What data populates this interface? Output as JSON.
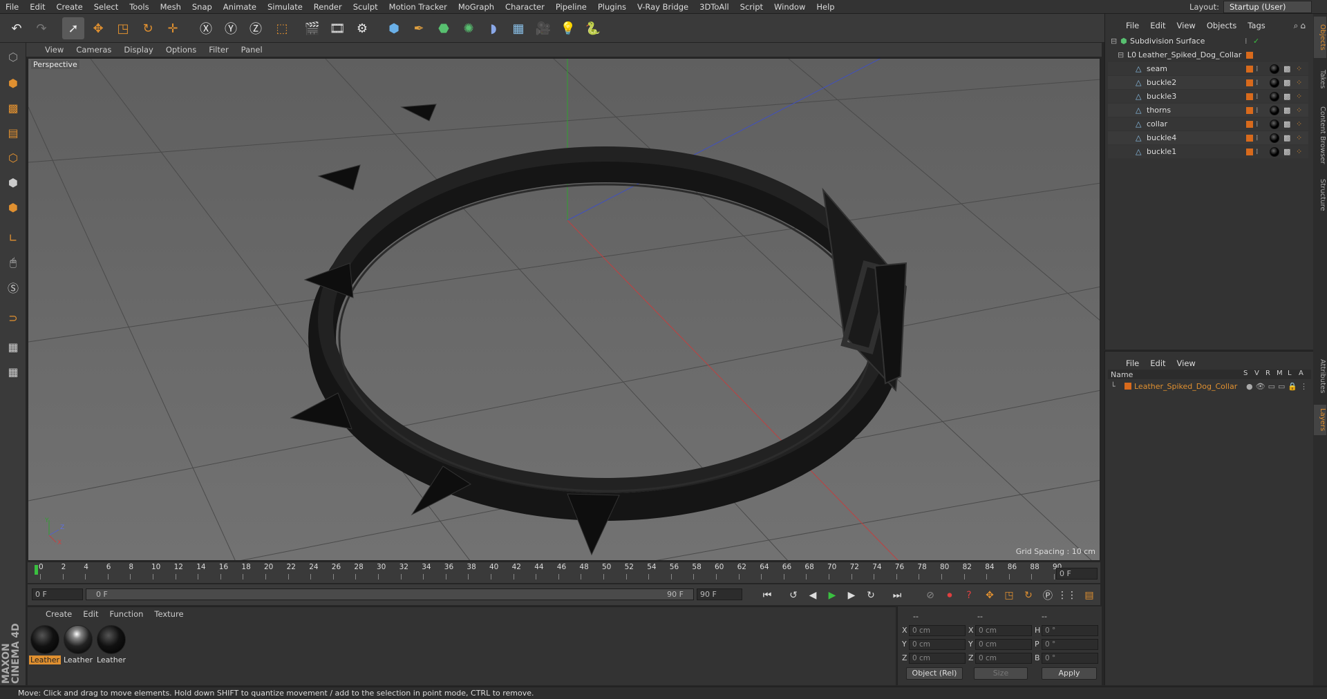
{
  "menubar": {
    "items": [
      "File",
      "Edit",
      "Create",
      "Select",
      "Tools",
      "Mesh",
      "Snap",
      "Animate",
      "Simulate",
      "Render",
      "Sculpt",
      "Motion Tracker",
      "MoGraph",
      "Character",
      "Pipeline",
      "Plugins",
      "V-Ray Bridge",
      "3DToAll",
      "Script",
      "Window",
      "Help"
    ],
    "layout_label": "Layout:",
    "layout_value": "Startup (User)"
  },
  "viewport": {
    "menu": [
      "View",
      "Cameras",
      "Display",
      "Options",
      "Filter",
      "Panel"
    ],
    "label": "Perspective",
    "grid_spacing": "Grid Spacing : 10 cm",
    "axis_x": "X",
    "axis_y": "Y",
    "axis_z": "Z"
  },
  "timeline": {
    "ticks": [
      "0",
      "2",
      "4",
      "6",
      "8",
      "10",
      "12",
      "14",
      "16",
      "18",
      "20",
      "22",
      "24",
      "26",
      "28",
      "30",
      "32",
      "34",
      "36",
      "38",
      "40",
      "42",
      "44",
      "46",
      "48",
      "50",
      "52",
      "54",
      "56",
      "58",
      "60",
      "62",
      "64",
      "66",
      "68",
      "70",
      "72",
      "74",
      "76",
      "78",
      "80",
      "82",
      "84",
      "86",
      "88",
      "90"
    ],
    "end_field": "0 F"
  },
  "playbar": {
    "start": "0 F",
    "range_start": "0 F",
    "range_end": "90 F",
    "end": "90 F"
  },
  "materials": {
    "menu": [
      "Create",
      "Edit",
      "Function",
      "Texture"
    ],
    "items": [
      "Leather",
      "Leather",
      "Leather"
    ]
  },
  "coords": {
    "rows": [
      {
        "l1": "X",
        "v1": "0 cm",
        "l2": "X",
        "v2": "0 cm",
        "l3": "H",
        "v3": "0 °"
      },
      {
        "l1": "Y",
        "v1": "0 cm",
        "l2": "Y",
        "v2": "0 cm",
        "l3": "P",
        "v3": "0 °"
      },
      {
        "l1": "Z",
        "v1": "0 cm",
        "l2": "Z",
        "v2": "0 cm",
        "l3": "B",
        "v3": "0 °"
      }
    ],
    "mode": "Object (Rel)",
    "size": "Size",
    "apply": "Apply",
    "header1": "--",
    "header2": "--",
    "header3": "--"
  },
  "objects": {
    "menu": [
      "File",
      "Edit",
      "View",
      "Objects",
      "Tags"
    ],
    "root": "Subdivision Surface",
    "parent": "Leather_Spiked_Dog_Collar",
    "children": [
      "seam",
      "buckle2",
      "buckle3",
      "thorns",
      "collar",
      "buckle4",
      "buckle1"
    ]
  },
  "layers": {
    "menu": [
      "File",
      "Edit",
      "View"
    ],
    "col_name": "Name",
    "cols": [
      "S",
      "V",
      "R",
      "M",
      "L",
      "A"
    ],
    "layer": "Leather_Spiked_Dog_Collar"
  },
  "rightstrip": {
    "tabs": [
      "Objects",
      "Takes",
      "Content Browser",
      "Structure",
      "Attributes",
      "Layers"
    ]
  },
  "status": "Move: Click and drag to move elements. Hold down SHIFT to quantize movement / add to the selection in point mode, CTRL to remove.",
  "brand": "MAXON CINEMA 4D",
  "colors": {
    "accent": "#e09030",
    "tag": "#d86a1c"
  }
}
